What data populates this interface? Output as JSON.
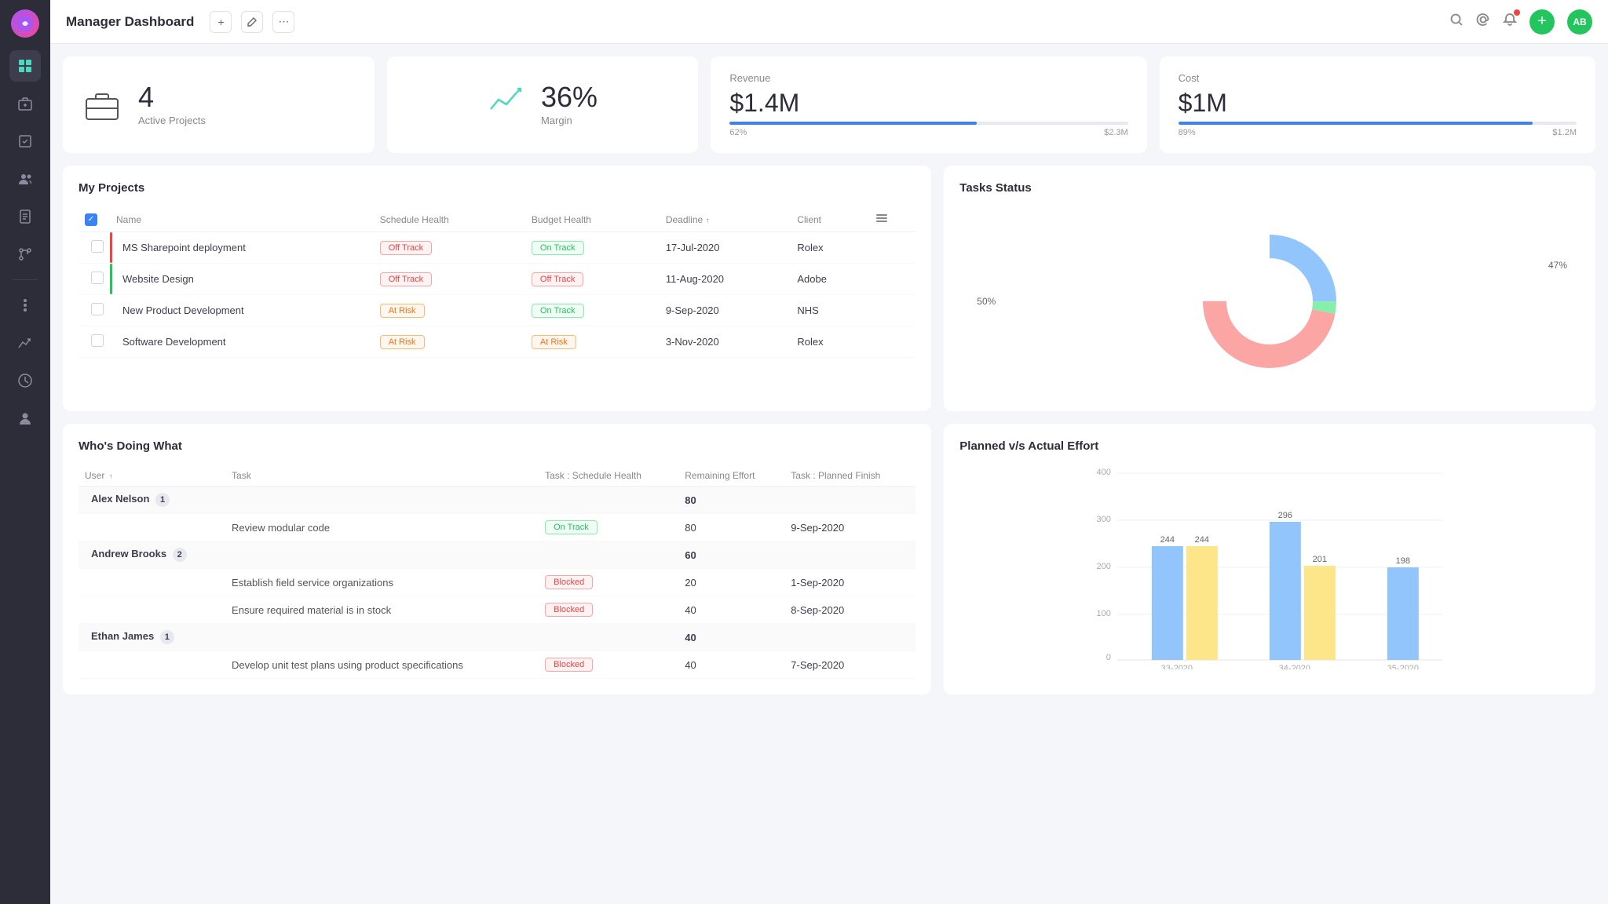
{
  "app": {
    "logo": "★",
    "title": "Manager Dashboard",
    "avatar": "AB"
  },
  "sidebar": {
    "items": [
      {
        "id": "dashboard",
        "icon": "⊡",
        "active": true
      },
      {
        "id": "briefcase",
        "icon": "💼",
        "active": false
      },
      {
        "id": "tasks",
        "icon": "✓",
        "active": false
      },
      {
        "id": "team",
        "icon": "👥",
        "active": false
      },
      {
        "id": "document",
        "icon": "📄",
        "active": false
      },
      {
        "id": "git",
        "icon": "⑂",
        "active": false
      },
      {
        "id": "more",
        "icon": "⋮",
        "active": false
      },
      {
        "id": "chart",
        "icon": "📊",
        "active": false
      },
      {
        "id": "clock",
        "icon": "⏱",
        "active": false
      },
      {
        "id": "user",
        "icon": "👤",
        "active": false
      }
    ]
  },
  "stats": {
    "active_projects": {
      "label": "Active Projects",
      "value": "4"
    },
    "margin": {
      "label": "Margin",
      "value": "36%"
    },
    "revenue": {
      "label": "Revenue",
      "amount": "$1.4M",
      "percent": "62%",
      "fill_width": 62,
      "max": "$2.3M"
    },
    "cost": {
      "label": "Cost",
      "amount": "$1M",
      "percent": "89%",
      "fill_width": 89,
      "max": "$1.2M"
    }
  },
  "projects": {
    "title": "My Projects",
    "columns": [
      "Name",
      "Schedule Health",
      "Budget Health",
      "Deadline",
      "Client"
    ],
    "rows": [
      {
        "name": "MS Sharepoint deployment",
        "schedule_health": "Off Track",
        "schedule_class": "badge-off-track",
        "budget_health": "On Track",
        "budget_class": "badge-on-track",
        "deadline": "17-Jul-2020",
        "client": "Rolex",
        "indicator": "#ef4444"
      },
      {
        "name": "Website Design",
        "schedule_health": "Off Track",
        "schedule_class": "badge-off-track",
        "budget_health": "Off Track",
        "budget_class": "badge-off-track",
        "deadline": "11-Aug-2020",
        "client": "Adobe",
        "indicator": "#22c55e"
      },
      {
        "name": "New Product Development",
        "schedule_health": "At Risk",
        "schedule_class": "badge-at-risk",
        "budget_health": "On Track",
        "budget_class": "badge-on-track",
        "deadline": "9-Sep-2020",
        "client": "NHS",
        "indicator": ""
      },
      {
        "name": "Software Development",
        "schedule_health": "At Risk",
        "schedule_class": "badge-at-risk",
        "budget_health": "At Risk",
        "budget_class": "badge-at-risk",
        "deadline": "3-Nov-2020",
        "client": "Rolex",
        "indicator": ""
      }
    ]
  },
  "tasks_status": {
    "title": "Tasks Status",
    "segments": [
      {
        "label": "50%",
        "color": "#93c5fd",
        "value": 50
      },
      {
        "label": "3%",
        "color": "#86efac",
        "value": 3
      },
      {
        "label": "47%",
        "color": "#fca5a5",
        "value": 47
      }
    ],
    "label_left": "50%",
    "label_right": "47%"
  },
  "wdw": {
    "title": "Who's Doing What",
    "columns": [
      "User",
      "Task",
      "Task : Schedule Health",
      "Remaining Effort",
      "Task : Planned Finish"
    ],
    "users": [
      {
        "name": "Alex Nelson",
        "badge": "1",
        "total_effort": "80",
        "tasks": [
          {
            "name": "Review modular code",
            "schedule_health": "On Track",
            "schedule_class": "badge-on-track",
            "remaining_effort": "80",
            "planned_finish": "9-Sep-2020"
          }
        ]
      },
      {
        "name": "Andrew Brooks",
        "badge": "2",
        "total_effort": "60",
        "tasks": [
          {
            "name": "Establish field service organizations",
            "schedule_health": "Blocked",
            "schedule_class": "badge-blocked",
            "remaining_effort": "20",
            "planned_finish": "1-Sep-2020"
          },
          {
            "name": "Ensure required material is in stock",
            "schedule_health": "Blocked",
            "schedule_class": "badge-blocked",
            "remaining_effort": "40",
            "planned_finish": "8-Sep-2020"
          }
        ]
      },
      {
        "name": "Ethan James",
        "badge": "1",
        "total_effort": "40",
        "tasks": [
          {
            "name": "Develop unit test plans using product specifications",
            "schedule_health": "Blocked",
            "schedule_class": "badge-blocked",
            "remaining_effort": "40",
            "planned_finish": "7-Sep-2020"
          }
        ]
      }
    ]
  },
  "effort_chart": {
    "title": "Planned v/s Actual Effort",
    "y_max": 400,
    "y_labels": [
      "400",
      "300",
      "200",
      "100",
      "0"
    ],
    "groups": [
      {
        "label": "33-2020",
        "planned": 244,
        "actual": 244,
        "planned_label": "244",
        "actual_label": "244"
      },
      {
        "label": "34-2020",
        "planned": 296,
        "actual": 201,
        "planned_label": "296",
        "actual_label": "201"
      },
      {
        "label": "35-2020",
        "planned": 198,
        "actual": null,
        "planned_label": "198",
        "actual_label": null
      }
    ],
    "colors": {
      "planned": "#93c5fd",
      "actual": "#fde68a"
    }
  }
}
